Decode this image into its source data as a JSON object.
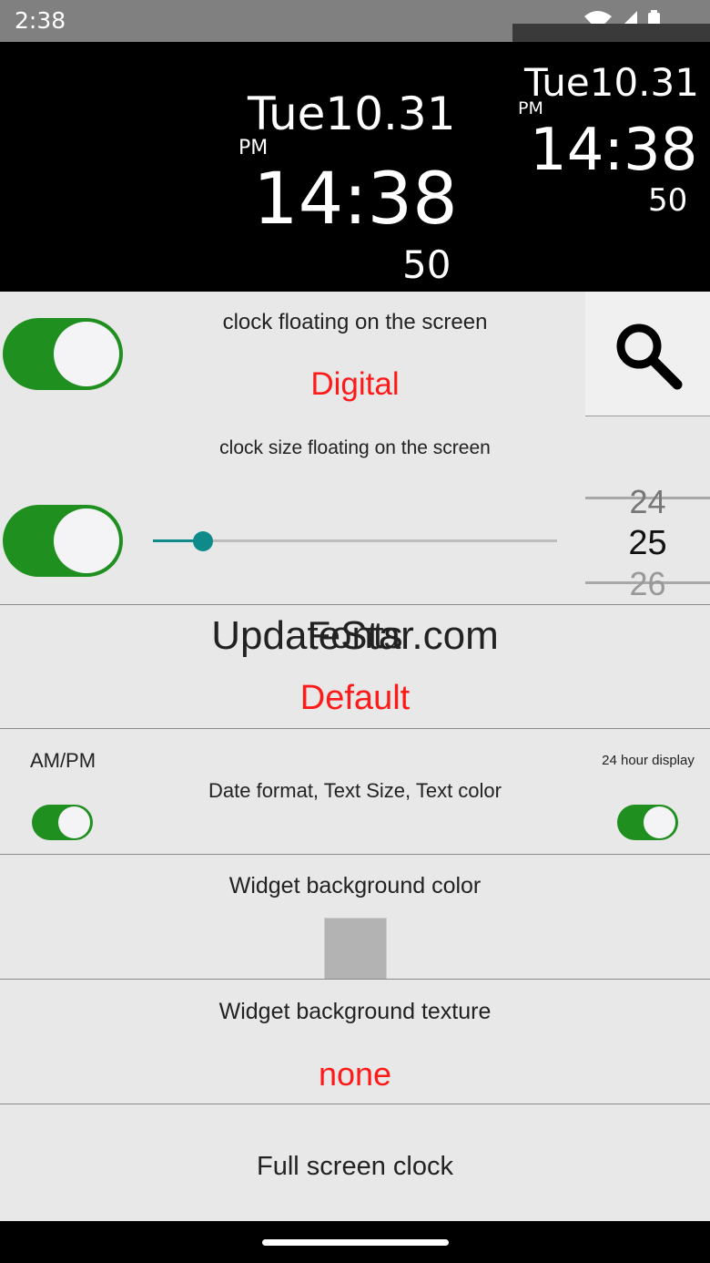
{
  "status_bar": {
    "time": "2:38",
    "icons": [
      "wifi-icon",
      "signal-icon",
      "battery-icon"
    ]
  },
  "preview_large": {
    "date": "Tue10.31",
    "ampm": "PM",
    "time": "14:38",
    "seconds": "50"
  },
  "preview_small": {
    "date": "Tue10.31",
    "ampm": "PM",
    "time": "14:38",
    "seconds": "50"
  },
  "floating": {
    "title": "clock floating on the screen",
    "value": "Digital",
    "enabled": true
  },
  "size": {
    "title": "clock size floating on the screen",
    "enabled": true,
    "slider_fraction": 0.12,
    "picker": {
      "prev": "24",
      "current": "25",
      "next": "26"
    }
  },
  "fonts": {
    "title": "Fonts",
    "value": "Default",
    "watermark": "UpdateStar.com"
  },
  "format": {
    "ampm_label": "AM/PM",
    "title": "Date format, Text Size, Text color",
    "hour24_label": "24 hour display",
    "ampm_on": true,
    "hour24_on": true
  },
  "widget_bg": {
    "title": "Widget background color",
    "swatch_color": "#b3b3b3"
  },
  "widget_texture": {
    "title": "Widget background texture",
    "value": "none"
  },
  "full_screen": {
    "label": "Full screen clock"
  },
  "colors": {
    "accent_green": "#1f8f1f",
    "value_red": "#ff1a1a",
    "slider_teal": "#0f8a8a"
  }
}
